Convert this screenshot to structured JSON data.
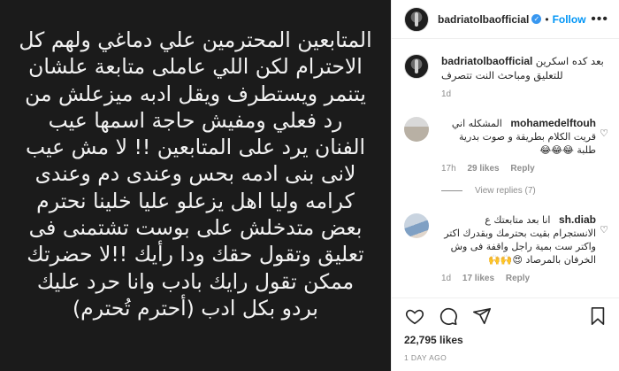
{
  "post": {
    "image_text_lines": [
      "المتابعين المحترمين علي دماغي ولهم كل",
      "الاحترام لكن اللي عاملى متابعة علشان",
      "يتنمر ويستطرف ويقل ادبه ميزعلش من",
      "رد فعلي ومفيش حاجة اسمها عيب",
      "الفنان يرد على المتابعين !! لا مش عيب",
      "لانى بنى ادمه بحس وعندى دم وعندى",
      "كرامه وليا اهل يزعلو عليا خلينا نحترم",
      "بعض متدخلش على بوست تشتمنى فى",
      "تعليق وتقول حقك ودا رأيك !!لا حضرتك",
      "ممكن تقول رايك بادب وانا حرد عليك",
      "بردو بكل ادب (أحترم تُحترم)"
    ]
  },
  "header": {
    "username": "badriatolbaofficial",
    "verified_glyph": "✓",
    "separator": "•",
    "follow_label": "Follow",
    "more_glyph": "•••"
  },
  "caption": {
    "username": "badriatolbaofficial",
    "text": "بعد كده اسكرين للتعليق ومباحث النت تتصرف",
    "time": "1d"
  },
  "comments": [
    {
      "username": "mohamedelftouh",
      "text": "المشكله اني قريت الكلام بطريقة و صوت بدرية طلبة 😂😂😂",
      "time": "17h",
      "likes": "29 likes",
      "reply": "Reply",
      "view_replies": "View replies (7)"
    },
    {
      "username": "sh.diab",
      "text": "انا بعد متابعتك ع الانستجرام بقيت بحترمك وبقدرك اكتر واكتر ست بمية راجل واقفة فى وش الخرفان بالمرصاد 😍🙌🙌",
      "time": "1d",
      "likes": "17 likes",
      "reply": "Reply"
    }
  ],
  "footer": {
    "likes": "22,795 likes",
    "time": "1 DAY AGO"
  },
  "icons": {
    "like": "heart-icon",
    "comment": "comment-icon",
    "share": "share-icon",
    "save": "bookmark-icon"
  },
  "colors": {
    "accent": "#0095f6",
    "image_bg": "#1b1b1b",
    "muted": "#8e8e8e"
  }
}
